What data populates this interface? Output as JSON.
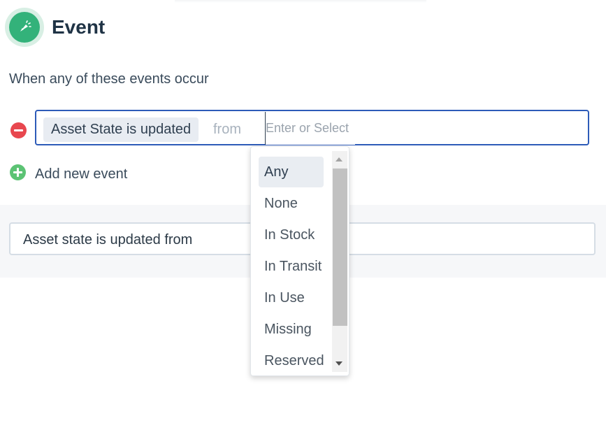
{
  "header": {
    "title": "Event",
    "icon": "event-trigger-icon",
    "icon_color": "#33b27a"
  },
  "subtitle": "When any of these events occur",
  "event_row": {
    "chip_label": "Asset State is updated",
    "from_label": "from",
    "input_placeholder": "Enter or Select",
    "input_value": "",
    "remove_icon": "minus-circle-icon"
  },
  "add_event": {
    "label": "Add new event",
    "icon": "plus-circle-icon"
  },
  "summary": {
    "text": "Asset state is updated from"
  },
  "dropdown": {
    "options": [
      "Any",
      "None",
      "In Stock",
      "In Transit",
      "In Use",
      "Missing",
      "Reserved"
    ],
    "highlighted": "Any"
  },
  "colors": {
    "accent_border": "#2d5bb8",
    "remove": "#e8474f",
    "add": "#5cc374"
  }
}
